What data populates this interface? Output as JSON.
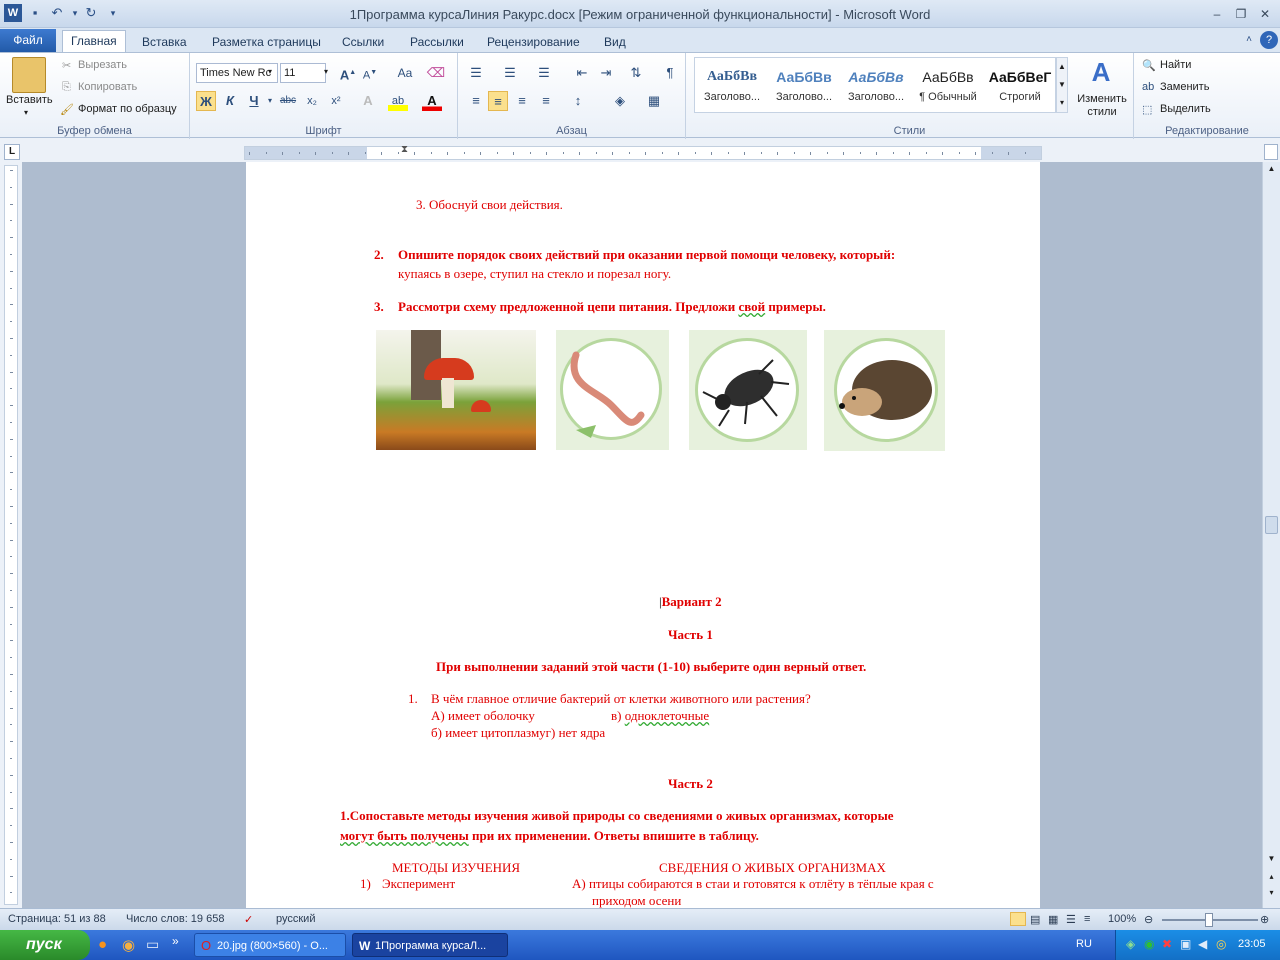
{
  "window": {
    "title": "1Программа курсаЛиния Ракурс.docx [Режим ограниченной функциональности]  -  Microsoft Word"
  },
  "tabs": [
    "Файл",
    "Главная",
    "Вставка",
    "Разметка страницы",
    "Ссылки",
    "Рассылки",
    "Рецензирование",
    "Вид"
  ],
  "ribbon": {
    "clipboard": {
      "paste": "Вставить",
      "cut": "Вырезать",
      "copy": "Копировать",
      "format_painter": "Формат по образцу",
      "label": "Буфер обмена"
    },
    "font": {
      "name": "Times New Rc",
      "size": "11",
      "label": "Шрифт",
      "case": "Aa",
      "bold": "Ж",
      "italic": "К",
      "underline": "Ч",
      "strike": "abc"
    },
    "paragraph": {
      "label": "Абзац"
    },
    "styles": {
      "label": "Стили",
      "items": [
        {
          "preview": "АаБбВв",
          "name": "Заголово..."
        },
        {
          "preview": "АаБбВв",
          "name": "Заголово..."
        },
        {
          "preview": "АаБбВв",
          "name": "Заголово..."
        },
        {
          "preview": "АаБбВв",
          "name": "¶ Обычный"
        },
        {
          "preview": "АаБбВеГ",
          "name": "Строгий"
        }
      ],
      "change": "Изменить стили"
    },
    "editing": {
      "find": "Найти",
      "replace": "Заменить",
      "select": "Выделить",
      "label": "Редактирование"
    }
  },
  "doc": {
    "line_justify": "3. Обоснуй свои действия.",
    "q2_num": "2.",
    "q2_title": "Опишите порядок своих действий при оказании первой помощи человеку, который:",
    "q2_text": "купаясь в озере, ступил на стекло и порезал ногу.",
    "q3_num": "3.",
    "q3_title_a": "Рассмотри схему предложенной цепи питания. Предложи ",
    "q3_title_sq": "свой",
    "q3_title_b": " примеры.",
    "variant": "Вариант 2",
    "part1": "Часть 1",
    "instruction": "При выполнении заданий этой части (1-10)  выберите один верный ответ.",
    "q1_num": "1.",
    "q1_text": "В чём главное отличие бактерий от клетки животного или растения?",
    "q1_a": "А) имеет оболочку",
    "q1_v_pre": "в) ",
    "q1_v": "одноклеточные",
    "q1_b": "б) имеет цитоплазму",
    "q1_g": "г) нет ядра",
    "part2": "Часть 2",
    "p2_line1": "1.Сопоставьте методы изучения живой природы со сведениями о живых организмах, которые",
    "p2_line2_sq": "могут быть получены",
    "p2_line2_b": " при их применении. Ответы впишите в таблицу.",
    "col1": "МЕТОДЫ ИЗУЧЕНИЯ",
    "col2": "СВЕДЕНИЯ О ЖИВЫХ ОРГАНИЗМАХ",
    "row1_num": "1)",
    "row1_method": "Эксперимент",
    "row1_info_a": "А) птицы собираются в стаи и готовятся к отлёту в тёплые края с",
    "row1_info_b": "приходом осени"
  },
  "status": {
    "page": "Страница: 51 из 88",
    "words": "Число слов: 19 658",
    "lang": "русский",
    "zoom": "100%"
  },
  "taskbar": {
    "start": "пуск",
    "task1": "20.jpg (800×560) - О...",
    "task2": "1Программа курсаЛ...",
    "lang": "RU",
    "clock": "23:05"
  }
}
